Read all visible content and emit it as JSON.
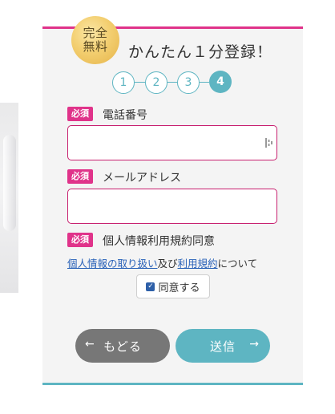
{
  "badge": {
    "line1": "完全",
    "line2": "無料"
  },
  "headline": "かんたん１分登録！",
  "steps": {
    "s1": "1",
    "s2": "2",
    "s3": "3",
    "s4": "4",
    "active_color": "#5eb5c2"
  },
  "required_label": "必須",
  "phone": {
    "label": "電話番号",
    "value": "",
    "placeholder": ""
  },
  "email": {
    "label": "メールアドレス",
    "value": "",
    "placeholder": ""
  },
  "consent": {
    "label": "個人情報利用規約同意",
    "privacy_link": "個人情報の取り扱い",
    "connector": "及び",
    "terms_link": "利用規約",
    "suffix": "について",
    "checkbox_label": "同意する",
    "checked": true
  },
  "buttons": {
    "back": "もどる",
    "send": "送信"
  },
  "colors": {
    "accent_pink": "#e0338a",
    "accent_teal": "#5eb5c2",
    "back_gray": "#777777"
  }
}
